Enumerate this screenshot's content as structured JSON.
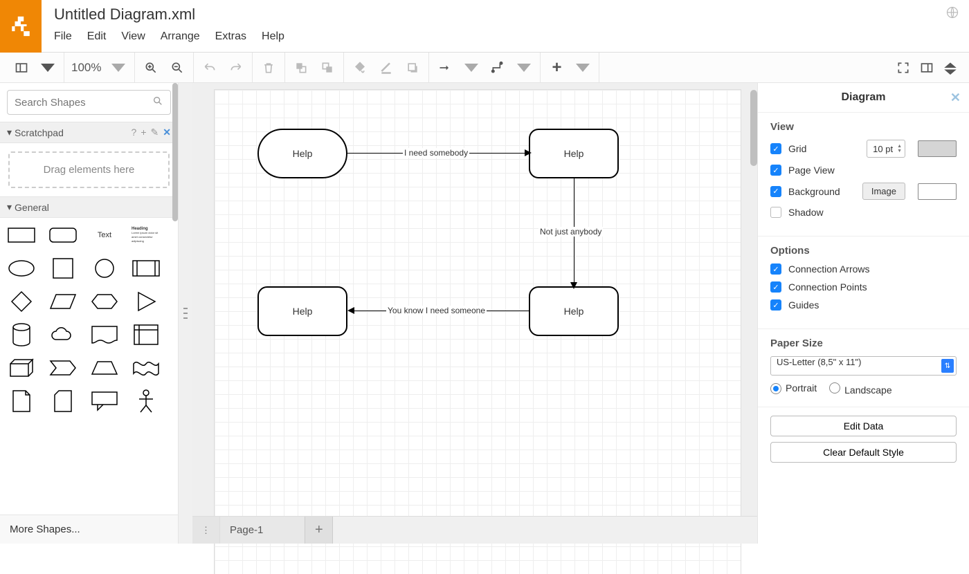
{
  "title": "Untitled Diagram.xml",
  "menu": [
    "File",
    "Edit",
    "View",
    "Arrange",
    "Extras",
    "Help"
  ],
  "toolbar": {
    "zoom": "100%"
  },
  "left": {
    "search_placeholder": "Search Shapes",
    "scratchpad": "Scratchpad",
    "drag_hint": "Drag elements here",
    "general": "General",
    "text_label": "Text",
    "heading_label": "Heading",
    "more_shapes": "More Shapes..."
  },
  "canvas": {
    "nodes": [
      {
        "id": "n1",
        "label": "Help"
      },
      {
        "id": "n2",
        "label": "Help"
      },
      {
        "id": "n3",
        "label": "Help"
      },
      {
        "id": "n4",
        "label": "Help"
      }
    ],
    "edges": [
      {
        "label": "I need somebody"
      },
      {
        "label": "Not just anybody"
      },
      {
        "label": "You know I need someone"
      }
    ]
  },
  "tabs": {
    "page1": "Page-1"
  },
  "right": {
    "title": "Diagram",
    "view_h": "View",
    "grid": "Grid",
    "grid_val": "10 pt",
    "page_view": "Page View",
    "background": "Background",
    "image_btn": "Image",
    "shadow": "Shadow",
    "options_h": "Options",
    "conn_arrows": "Connection Arrows",
    "conn_points": "Connection Points",
    "guides": "Guides",
    "paper_h": "Paper Size",
    "paper_sel": "US-Letter (8,5\" x 11\")",
    "portrait": "Portrait",
    "landscape": "Landscape",
    "edit_data": "Edit Data",
    "clear_style": "Clear Default Style"
  }
}
